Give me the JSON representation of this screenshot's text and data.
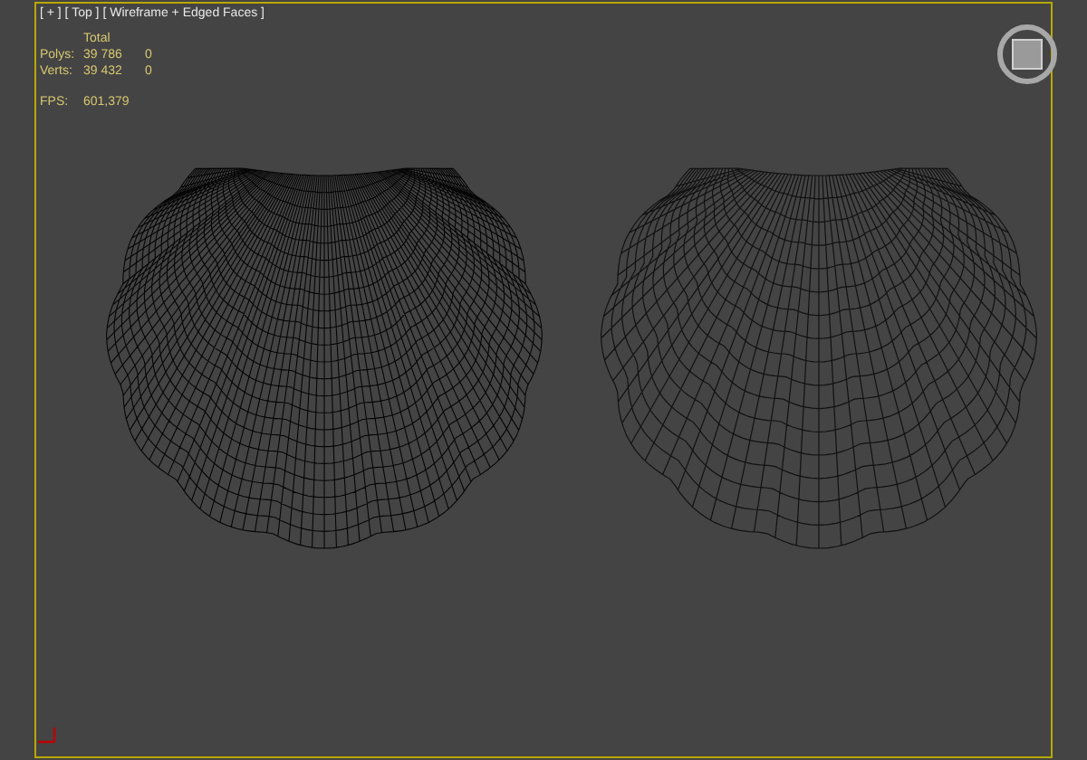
{
  "viewport": {
    "label": "[ + ] [ Top ] [ Wireframe + Edged Faces ]"
  },
  "stats": {
    "header": "Total",
    "rows": [
      {
        "name": "Polys:",
        "total": "39 786",
        "selected": "0"
      },
      {
        "name": "Verts:",
        "total": "39 432",
        "selected": "0"
      }
    ],
    "fps_label": "FPS:",
    "fps": "601,379"
  }
}
